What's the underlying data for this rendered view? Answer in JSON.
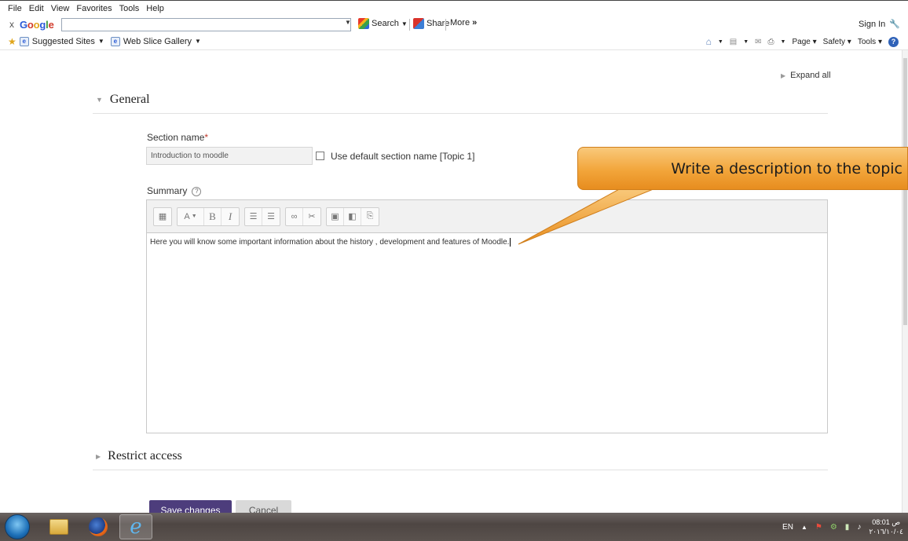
{
  "menu": [
    "File",
    "Edit",
    "View",
    "Favorites",
    "Tools",
    "Help"
  ],
  "google_bar": {
    "close": "x",
    "logo_parts": [
      "G",
      "o",
      "o",
      "g",
      "l",
      "e"
    ],
    "search_label": "Search",
    "share_label": "Share",
    "more_label": "More",
    "more_chevron": "»",
    "sign_in": "Sign In"
  },
  "favorites": {
    "suggested_sites": "Suggested Sites",
    "web_slice_gallery": "Web Slice Gallery",
    "page_menu": "Page",
    "safety_menu": "Safety",
    "tools_menu": "Tools"
  },
  "form": {
    "expand_all": "Expand all",
    "general_heading": "General",
    "section_name_label": "Section name",
    "required_mark": "*",
    "section_name_value": "Introduction to moodle",
    "use_default_label": "Use default section name [Topic 1]",
    "summary_label": "Summary",
    "help_glyph": "?",
    "summary_text": "Here you will know some important information about the history , development and features of Moodle.",
    "restrict_access_heading": "Restrict access",
    "save_button": "Save changes",
    "cancel_button": "Cancel"
  },
  "toolbar_glyphs": {
    "font_size": "A",
    "bold": "B",
    "italic": "I",
    "unordered_list": "☰",
    "ordered_list": "☰",
    "link": "∞",
    "unlink": "✂",
    "image": "▣",
    "media": "◧",
    "paste": "⎘"
  },
  "callout": {
    "text": "Write a description to the topic"
  },
  "taskbar": {
    "language": "EN",
    "time": "08:01 ص",
    "date": "٢٠١٦/١٠/٠٤"
  },
  "colors": {
    "save_button": "#4d3d7c",
    "callout": "#f2a53a",
    "taskbar": "#4e4643"
  }
}
